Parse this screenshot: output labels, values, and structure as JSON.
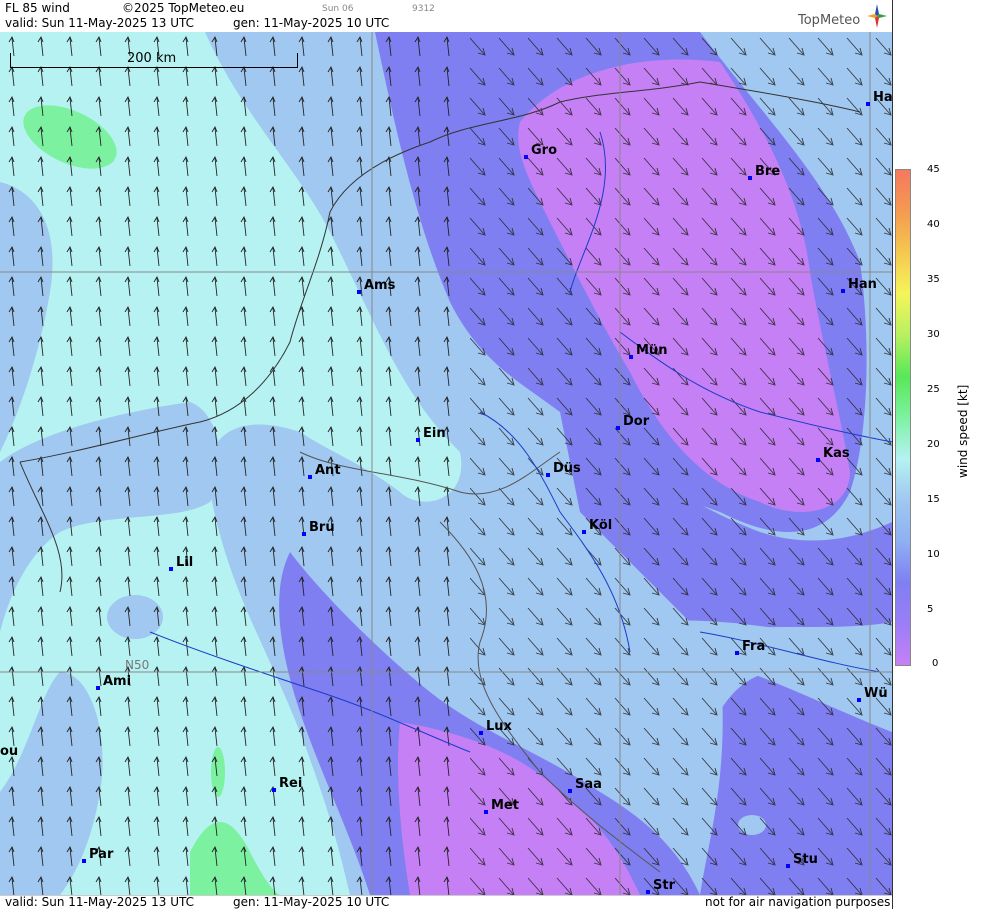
{
  "header": {
    "title": "FL 85 wind",
    "copyright": "©2025 TopMeteo.eu",
    "valid": "valid:  Sun  11-May-2025  13 UTC",
    "generated": "gen: 11-May-2025 10 UTC",
    "small_label": "Sun 06",
    "small_code": "9312",
    "brand": "TopMeteo"
  },
  "scale_bar": {
    "label": "200 km"
  },
  "grid_label": "N50",
  "cities": [
    {
      "name": "Gro"
    },
    {
      "name": "Bre"
    },
    {
      "name": "Ha"
    },
    {
      "name": "Ams"
    },
    {
      "name": "Han"
    },
    {
      "name": "Mün"
    },
    {
      "name": "Dor"
    },
    {
      "name": "Kas"
    },
    {
      "name": "Ein"
    },
    {
      "name": "Ant"
    },
    {
      "name": "Düs"
    },
    {
      "name": "Köl"
    },
    {
      "name": "Bru"
    },
    {
      "name": "Lil"
    },
    {
      "name": "Fra"
    },
    {
      "name": "Ami"
    },
    {
      "name": "Wü"
    },
    {
      "name": "Lux"
    },
    {
      "name": "ou"
    },
    {
      "name": "Rei"
    },
    {
      "name": "Saa"
    },
    {
      "name": "Met"
    },
    {
      "name": "Par"
    },
    {
      "name": "Stu"
    },
    {
      "name": "Str"
    }
  ],
  "legend": {
    "title": "wind  speed  [kt]",
    "ticks": [
      "45",
      "40",
      "35",
      "30",
      "25",
      "20",
      "15",
      "10",
      "5",
      "0"
    ],
    "colors": [
      "#c680f5",
      "#9b7ef7",
      "#7f7ff2",
      "#8fb0f2",
      "#a0c8f0",
      "#b6f2f2",
      "#7cf2a0",
      "#58e858",
      "#b8f060",
      "#f5f55a",
      "#f5c850",
      "#f59a50",
      "#f57860"
    ]
  },
  "footer": {
    "valid": "valid:  Sun  11-May-2025  13 UTC",
    "generated": "gen: 11-May-2025 10 UTC",
    "disclaimer": "not for air navigation purposes"
  }
}
